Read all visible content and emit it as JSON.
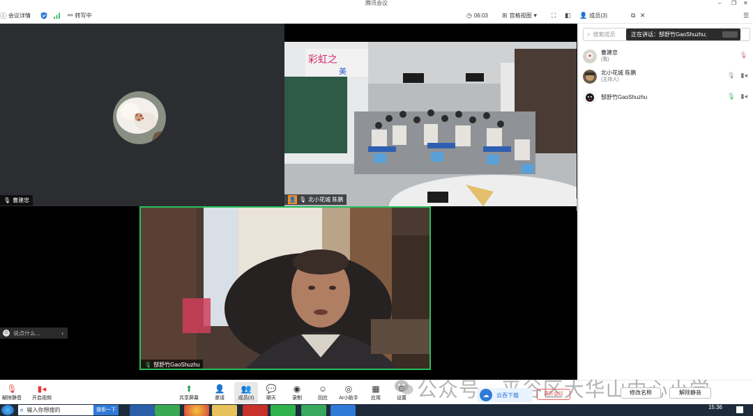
{
  "window": {
    "title": "腾讯会议",
    "minimize": "–",
    "maximize": "❐",
    "close": "✕"
  },
  "toolbar": {
    "meeting_info": "会议详情",
    "transcribe": "转写中",
    "timer": "06:03",
    "view_mode": "宫格视图",
    "members_tab": "成员(3)"
  },
  "tiles": {
    "top_left": {
      "name": "曹建忠"
    },
    "top_right": {
      "name": "北小花城 陈鹏"
    },
    "main": {
      "name": "郜舒竹GaoShuzhu"
    },
    "chat_placeholder": "说点什么..."
  },
  "members_panel": {
    "search_placeholder": "搜索成员",
    "speaking_prefix": "正在讲话：",
    "speaking_name": "郜舒竹GaoShuzhu;",
    "members": [
      {
        "name": "曹建忠",
        "role": "(我)"
      },
      {
        "name": "北小花城 陈鹏",
        "role": "(主持人)"
      },
      {
        "name": "郜舒竹GaoShuzhu",
        "role": ""
      }
    ]
  },
  "bottombar": {
    "unmute": "解除静音",
    "start_video": "开启视频",
    "share_screen": "共享屏幕",
    "invite": "邀请",
    "members": "成员(3)",
    "chat": "聊天",
    "record": "录制",
    "reactions": "回应",
    "ai_assistant": "AI小助手",
    "apps": "应用",
    "settings": "设置",
    "cloud_download": "云吞下载",
    "leave": "离开会议",
    "rename": "修改名称",
    "unmute_all": "解除静音"
  },
  "watermark": "公众号 · 平谷区大华山中心小学",
  "taskbar": {
    "search_text": "输入你想搜的",
    "search_button": "搜索一下",
    "clock": "15:36"
  },
  "colors": {
    "accent": "#2f7ad6",
    "speaker_border": "#28c05e",
    "host_badge": "#f08a24",
    "leave_red": "#e35a5a"
  }
}
